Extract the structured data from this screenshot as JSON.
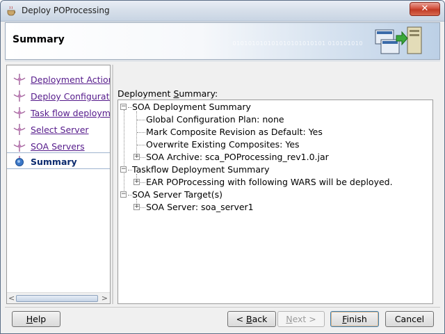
{
  "window": {
    "title": "Deploy POProcessing",
    "close_glyph": "✕"
  },
  "header": {
    "title": "Summary",
    "decor_binary": "010101010101010101010101 010101010"
  },
  "nav": {
    "items": [
      {
        "label": "Deployment Action",
        "state": "visited"
      },
      {
        "label": "Deploy Configuration",
        "state": "visited"
      },
      {
        "label": "Task flow deployment",
        "state": "visited"
      },
      {
        "label": "Select Server",
        "state": "visited"
      },
      {
        "label": "SOA Servers",
        "state": "visited"
      },
      {
        "label": "Summary",
        "state": "current"
      }
    ]
  },
  "summary": {
    "label_pre": "Deployment ",
    "label_mnemonic": "S",
    "label_post": "ummary:",
    "tree": {
      "soa_summary": "SOA Deployment Summary",
      "global_config": "Global Configuration Plan: none",
      "mark_composite": "Mark Composite Revision as Default: Yes",
      "overwrite": "Overwrite Existing Composites: Yes",
      "soa_archive": "SOA Archive: sca_POProcessing_rev1.0.jar",
      "taskflow_summary": "Taskflow Deployment Summary",
      "ear_text": "EAR POProcessing with following WARS will be deployed.",
      "server_targets": "SOA Server Target(s)",
      "soa_server": "SOA Server: soa_server1"
    }
  },
  "buttons": {
    "help_mn": "H",
    "help_rest": "elp",
    "back_arrow": "< ",
    "back_mn": "B",
    "back_rest": "ack",
    "next_mn": "N",
    "next_rest": "ext >",
    "finish_mn": "F",
    "finish_rest": "inish",
    "cancel": "Cancel"
  },
  "colors": {
    "visited_link": "#551a8b",
    "current_item": "#0a2a6e",
    "close_red": "#c03a25"
  }
}
